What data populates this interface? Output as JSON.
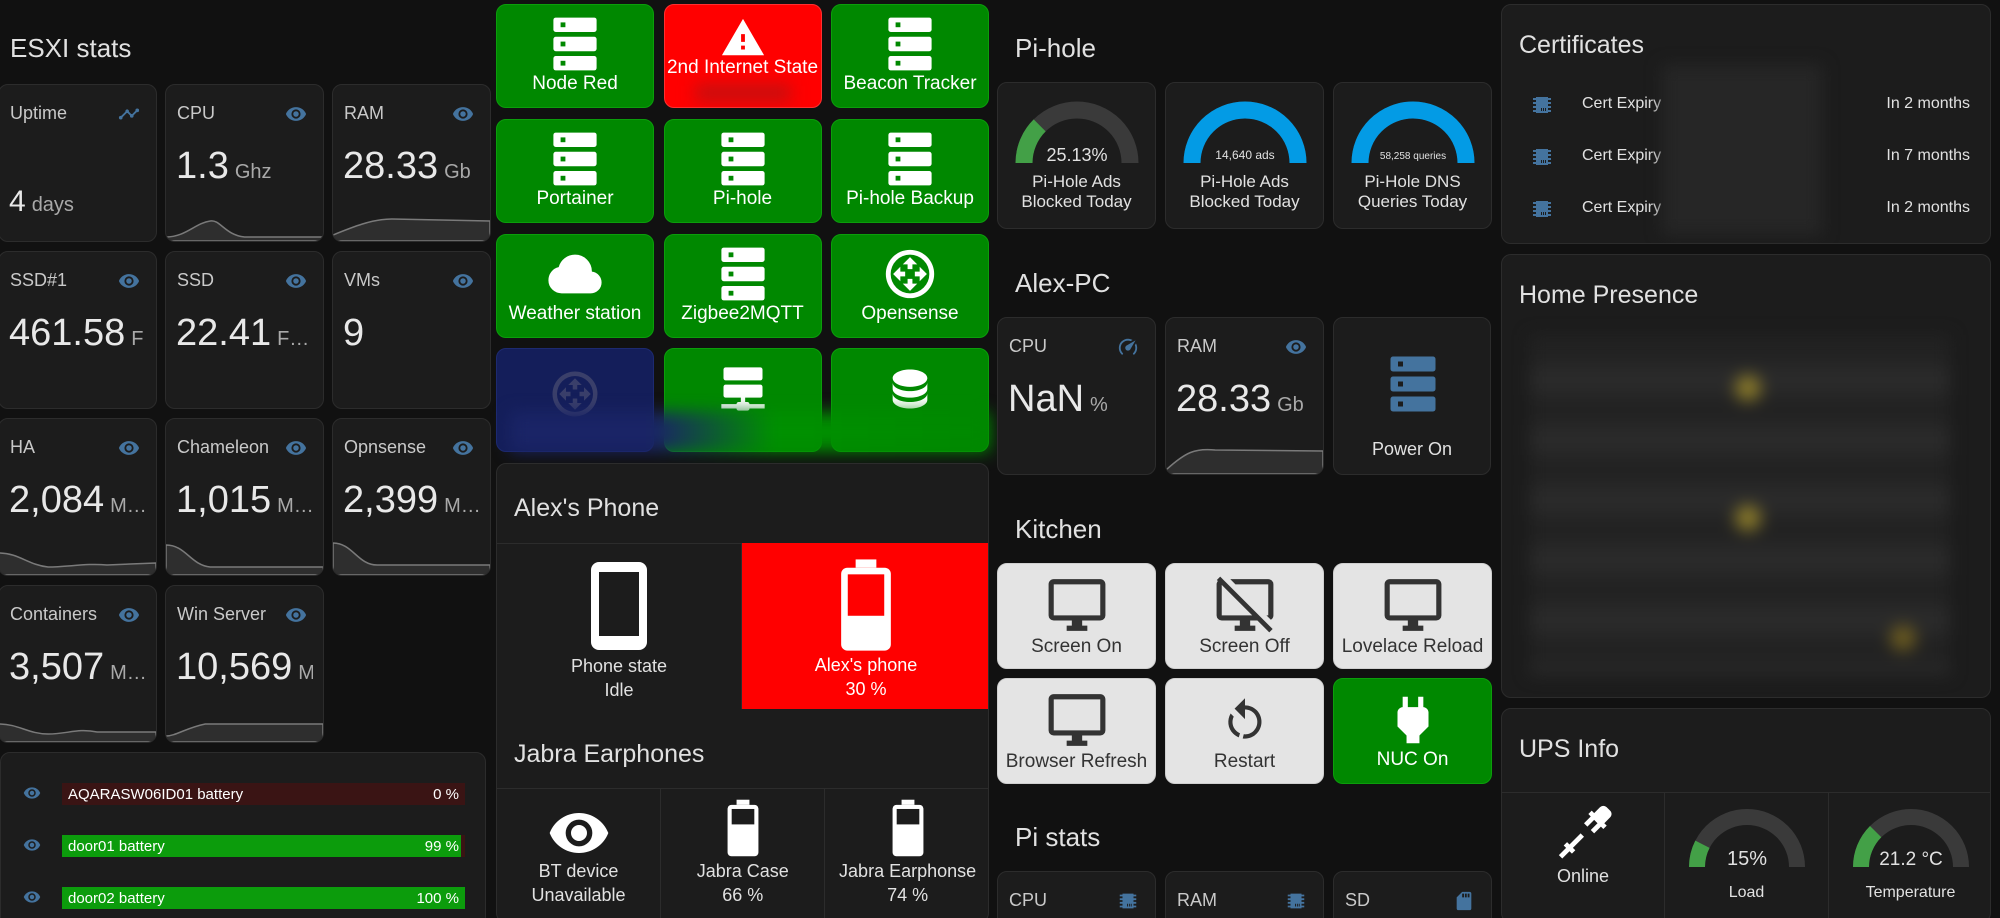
{
  "esxi": {
    "title": "ESXI stats",
    "sensors": [
      {
        "name": "Uptime",
        "value": "4",
        "unit": "days",
        "icon": "chart-icon"
      },
      {
        "name": "CPU",
        "value": "1.3",
        "unit": "Ghz",
        "icon": "eye-icon"
      },
      {
        "name": "RAM",
        "value": "28.33",
        "unit": "Gb",
        "icon": "eye-icon"
      },
      {
        "name": "SSD#1",
        "value": "461.58",
        "unit": "F",
        "icon": "eye-icon"
      },
      {
        "name": "SSD",
        "value": "22.41",
        "unit": "F…",
        "icon": "eye-icon"
      },
      {
        "name": "VMs",
        "value": "9",
        "unit": "",
        "icon": "eye-icon"
      },
      {
        "name": "HA",
        "value": "2,084",
        "unit": "M…",
        "icon": "eye-icon"
      },
      {
        "name": "Chameleon",
        "value": "1,015",
        "unit": "M…",
        "icon": "eye-icon"
      },
      {
        "name": "Opnsense",
        "value": "2,399",
        "unit": "M…",
        "icon": "eye-icon"
      },
      {
        "name": "Containers",
        "value": "3,507",
        "unit": "M…",
        "icon": "eye-icon"
      },
      {
        "name": "Win Server",
        "value": "10,569",
        "unit": "M",
        "icon": "eye-icon"
      }
    ],
    "batteries": [
      {
        "label": "AQARASW06ID01 battery",
        "value": "0 %",
        "level": 0
      },
      {
        "label": "door01 battery",
        "value": "99 %",
        "level": 99
      },
      {
        "label": "door02 battery",
        "value": "100 %",
        "level": 100
      }
    ]
  },
  "tiles": [
    {
      "label": "Node Red",
      "icon": "server-icon",
      "color": "#008800"
    },
    {
      "label": "2nd Internet State",
      "icon": "alert-icon",
      "color": "#ff0000"
    },
    {
      "label": "Beacon Tracker",
      "icon": "server-icon",
      "color": "#008800"
    },
    {
      "label": "Portainer",
      "icon": "server-icon",
      "color": "#008800"
    },
    {
      "label": "Pi-hole",
      "icon": "server-icon",
      "color": "#008800"
    },
    {
      "label": "Pi-hole Backup",
      "icon": "server-icon",
      "color": "#008800"
    },
    {
      "label": "Weather station",
      "icon": "cloud-icon",
      "color": "#008800"
    },
    {
      "label": "Zigbee2MQTT",
      "icon": "server-icon",
      "color": "#008800"
    },
    {
      "label": "Opensense",
      "icon": "router-icon",
      "color": "#008800"
    }
  ],
  "phone": {
    "title": "Alex's Phone",
    "state_name": "Phone state",
    "state_value": "Idle",
    "battery_name": "Alex's phone",
    "battery_value": "30 %",
    "battery_level": 30
  },
  "jabra": {
    "title": "Jabra Earphones",
    "items": [
      {
        "name": "BT device",
        "value": "Unavailable",
        "icon": "eye-icon"
      },
      {
        "name": "Jabra Case",
        "value": "66 %",
        "icon": "battery-icon"
      },
      {
        "name": "Jabra Earphonse",
        "value": "74 %",
        "icon": "battery-icon"
      }
    ]
  },
  "pihole": {
    "title": "Pi-hole",
    "gauges": [
      {
        "value_text": "25.13%",
        "level": 25.13,
        "label1": "Pi-Hole Ads",
        "label2": "Blocked Today",
        "color": "#43a047"
      },
      {
        "value_text": "14,640 ads",
        "level": 100,
        "label1": "Pi-Hole Ads",
        "label2": "Blocked Today",
        "color": "#039be5"
      },
      {
        "value_text": "58,258 queries",
        "level": 100,
        "label1": "Pi-Hole DNS",
        "label2": "Queries Today",
        "color": "#039be5"
      }
    ]
  },
  "alexpc": {
    "title": "Alex-PC",
    "cpu_name": "CPU",
    "cpu_value": "NaN",
    "cpu_unit": "%",
    "ram_name": "RAM",
    "ram_value": "28.33",
    "ram_unit": "Gb",
    "power_label": "Power On"
  },
  "kitchen": {
    "title": "Kitchen",
    "buttons": [
      {
        "label": "Screen On",
        "icon": "monitor-icon"
      },
      {
        "label": "Screen Off",
        "icon": "monitor-off-icon"
      },
      {
        "label": "Lovelace Reload",
        "icon": "monitor-icon"
      },
      {
        "label": "Browser Refresh",
        "icon": "monitor-icon"
      },
      {
        "label": "Restart",
        "icon": "restart-icon"
      },
      {
        "label": "NUC On",
        "icon": "plug-icon"
      }
    ]
  },
  "pistats": {
    "title": "Pi stats",
    "items": [
      {
        "name": "CPU",
        "icon": "chip-icon"
      },
      {
        "name": "RAM",
        "icon": "chip-icon"
      },
      {
        "name": "SD",
        "icon": "sd-card-icon"
      }
    ]
  },
  "certs": {
    "title": "Certificates",
    "rows": [
      {
        "name": "Cert Expiry",
        "value": "In 2 months"
      },
      {
        "name": "Cert Expiry",
        "value": "In 7 months"
      },
      {
        "name": "Cert Expiry",
        "value": "In 2 months"
      }
    ]
  },
  "presence": {
    "title": "Home Presence"
  },
  "ups": {
    "title": "UPS Info",
    "status": "Online",
    "load_text": "15%",
    "load_level": 15,
    "load_label": "Load",
    "temp_text": "21.2 °C",
    "temp_level": 25,
    "temp_label": "Temperature"
  },
  "colors": {
    "green": "#008800",
    "red": "#ff0000",
    "blue": "#039be5",
    "icon_blue": "#44739e"
  }
}
